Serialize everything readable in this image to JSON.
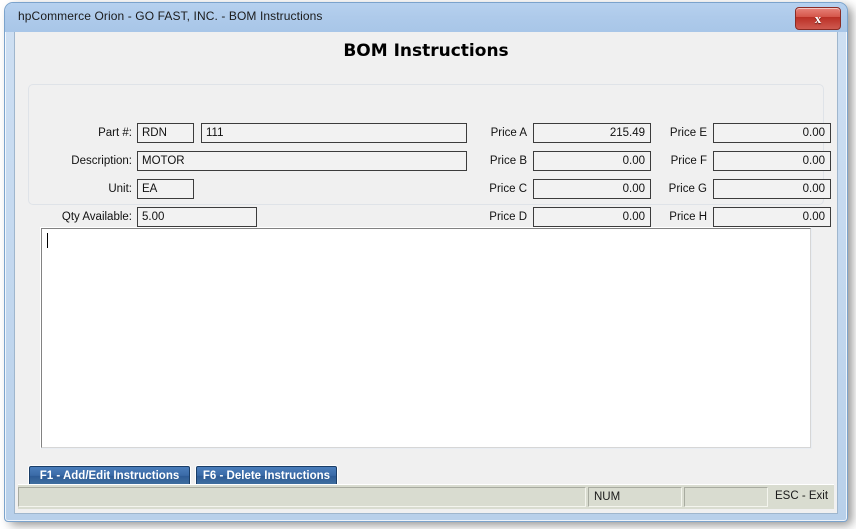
{
  "window": {
    "title": "hpCommerce Orion - GO FAST, INC. - BOM Instructions",
    "close_label": "x",
    "close_icon": "close-icon"
  },
  "page": {
    "heading": "BOM Instructions"
  },
  "info_panel": {
    "fields": [
      {
        "label": "Part #:",
        "value": "RDN"
      },
      {
        "label": "Description:",
        "value": "MOTOR"
      },
      {
        "label": "Unit:",
        "value": "EA"
      },
      {
        "label": "Qty Available:",
        "value": "5.00"
      }
    ],
    "part_number_value": "111",
    "prices_left": [
      {
        "label": "Price A",
        "value": "215.49"
      },
      {
        "label": "Price B",
        "value": "0.00"
      },
      {
        "label": "Price C",
        "value": "0.00"
      },
      {
        "label": "Price D",
        "value": "0.00"
      }
    ],
    "prices_right": [
      {
        "label": "Price E",
        "value": "0.00"
      },
      {
        "label": "Price F",
        "value": "0.00"
      },
      {
        "label": "Price G",
        "value": "0.00"
      },
      {
        "label": "Price H",
        "value": "0.00"
      }
    ]
  },
  "instructions": {
    "text": "",
    "placeholder": ""
  },
  "buttons": [
    {
      "label": "F1 - Add/Edit Instructions"
    },
    {
      "label": "F6 - Delete Instructions"
    }
  ],
  "statusbar": {
    "panel1": "",
    "panel2": "NUM",
    "panel3": "",
    "exit_hint": "ESC - Exit"
  },
  "colors": {
    "titlebar": "#aecaea",
    "frame_border": "#7ba3cc",
    "content_bg": "#f0f0f0",
    "button_blue": "#3a6aa6",
    "close_red": "#ba2f25",
    "statusbar_bg": "#d9dcd0",
    "field_bg": "#f2f2f2"
  }
}
